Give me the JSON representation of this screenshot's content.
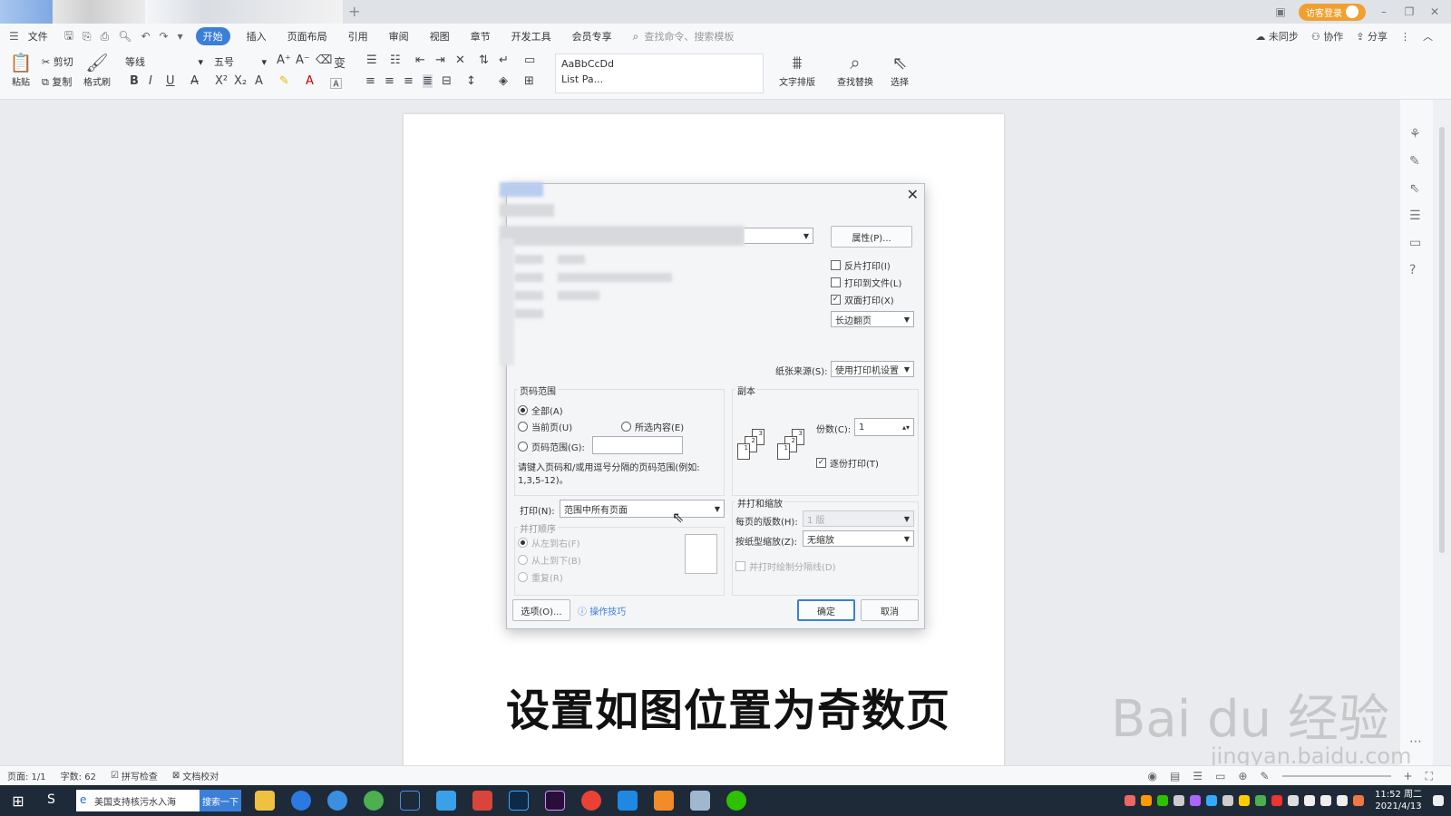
{
  "tabbar": {
    "add_icon": "+",
    "login_label": "访客登录"
  },
  "menu": {
    "file": "文件",
    "items": [
      "开始",
      "插入",
      "页面布局",
      "引用",
      "审阅",
      "视图",
      "章节",
      "开发工具",
      "会员专享"
    ],
    "search_placeholder": "查找命令、搜索模板",
    "sync": "未同步",
    "collab": "协作",
    "share": "分享"
  },
  "ribbon": {
    "paste": "粘贴",
    "cut": "剪切",
    "copy": "复制",
    "format_painter": "格式刷",
    "font_name": "等线",
    "font_size": "五号",
    "style_sample": "AaBbCcDd",
    "style_name": "List Pa...",
    "text_layout": "文字排版",
    "find_replace": "查找替换",
    "select": "选择"
  },
  "dialog": {
    "properties_btn": "属性(P)...",
    "reverse_print": "反片打印(I)",
    "print_to_file": "打印到文件(L)",
    "duplex_print": "双面打印(X)",
    "duplex_mode": "长边翻页",
    "paper_source_label": "纸张来源(S):",
    "paper_source_value": "使用打印机设置",
    "page_range_title": "页码范围",
    "all_label": "全部(A)",
    "current_page_label": "当前页(U)",
    "selection_label": "所选内容(E)",
    "page_range_label": "页码范围(G):",
    "range_hint_1": "请键入页码和/或用逗号分隔的页码范围(例如:",
    "range_hint_2": "1,3,5-12)。",
    "print_label": "打印(N):",
    "print_value": "范围中所有页面",
    "copies_title": "副本",
    "copies_label": "份数(C):",
    "copies_value": "1",
    "collate_label": "逐份打印(T)",
    "combine_order_title": "并打顺序",
    "order_lr": "从左到右(F)",
    "order_tb": "从上到下(B)",
    "order_repeat": "重复(R)",
    "zoom_title": "并打和缩放",
    "pages_per_sheet_label": "每页的版数(H):",
    "pages_per_sheet_value": "1 版",
    "scale_label": "按纸型缩放(Z):",
    "scale_value": "无缩放",
    "draw_divider": "并打时绘制分隔线(D)",
    "options_btn": "选项(O)...",
    "tips_link": "操作技巧",
    "ok_btn": "确定",
    "cancel_btn": "取消"
  },
  "caption": "设置如图位置为奇数页",
  "watermark": {
    "brand": "Bai du 经验",
    "url": "jingyan.baidu.com"
  },
  "statusbar": {
    "page": "页面: 1/1",
    "words": "字数: 62",
    "spellcheck": "拼写检查",
    "doc_check": "文档校对"
  },
  "taskbar": {
    "search_text": "美国支持核污水入海",
    "search_btn": "搜索一下",
    "time": "11:52 周二",
    "date": "2021/4/13"
  }
}
